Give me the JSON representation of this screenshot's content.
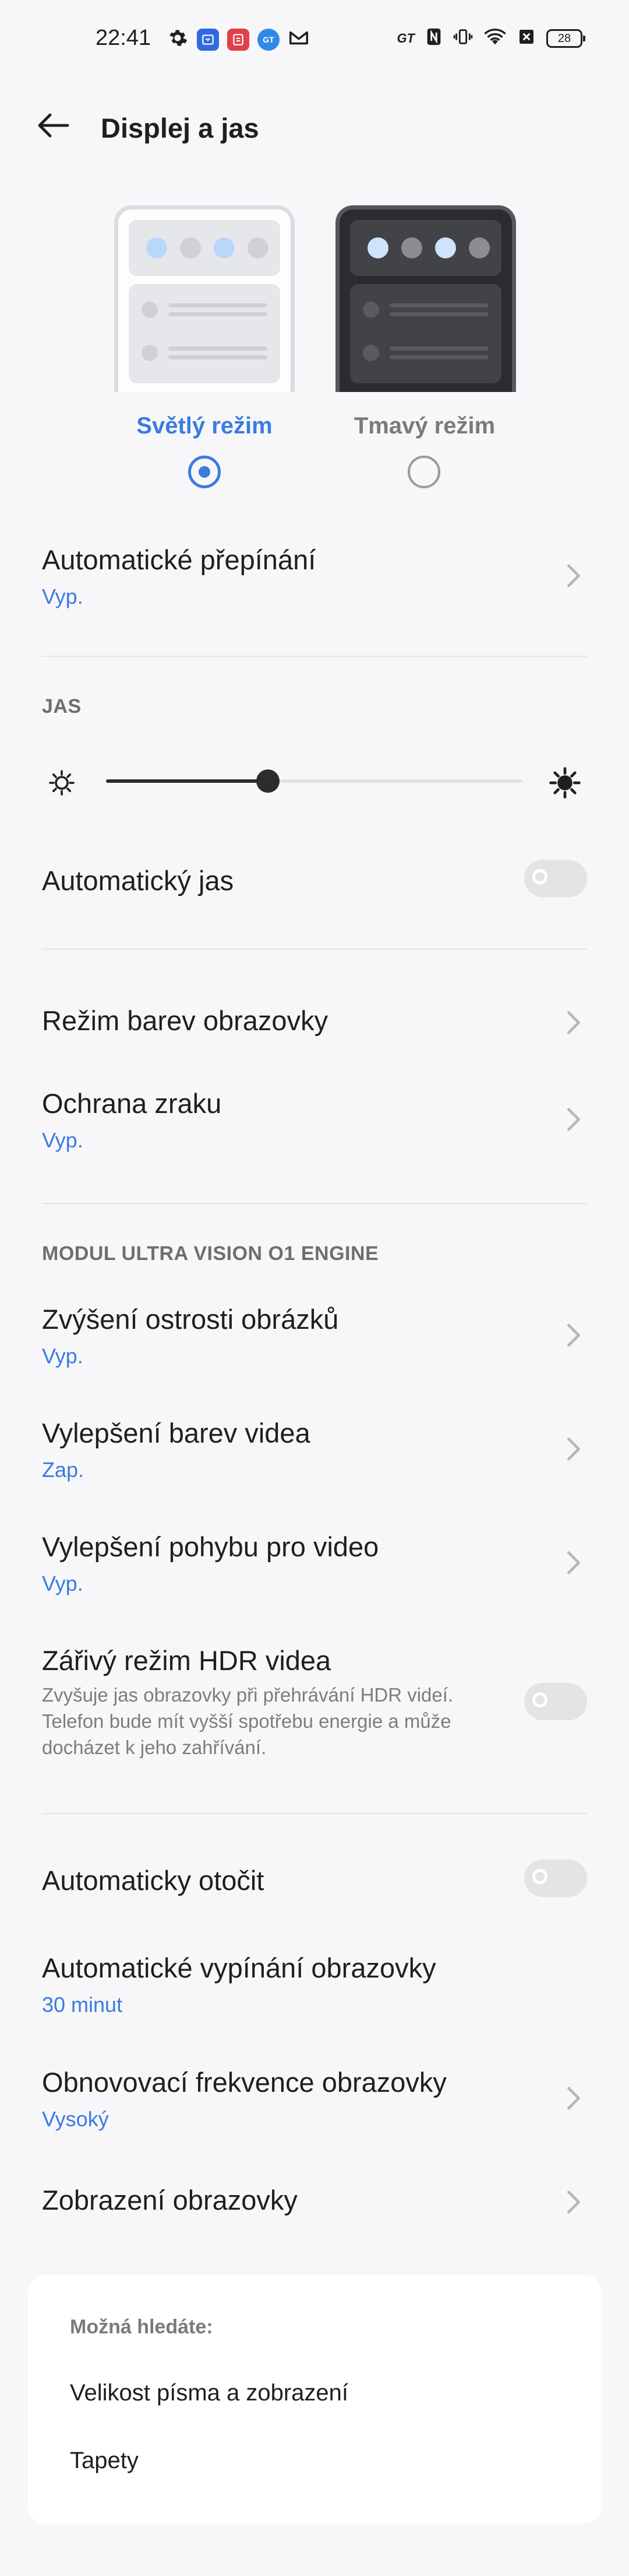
{
  "status_bar": {
    "time": "22:41",
    "left_icons": [
      "gear-icon",
      "app-icon-blue",
      "app-icon-red",
      "app-icon-gt",
      "gmail-icon"
    ],
    "right_icons": [
      "gt-mode-icon",
      "nfc-icon",
      "vibrate-icon",
      "wifi-icon",
      "no-sim-icon"
    ],
    "gt_badge": "GT",
    "battery": "28"
  },
  "header": {
    "title": "Displej a jas"
  },
  "theme": {
    "light_label": "Světlý režim",
    "dark_label": "Tmavý režim",
    "selected": "light",
    "light_dot_colors": [
      "#b9d6fb",
      "#d0d1d5",
      "#b9d6fb",
      "#d0d1d5"
    ],
    "dark_dot_colors": [
      "#cfe3fd",
      "#8c8d91",
      "#cfe3fd",
      "#8c8d91"
    ]
  },
  "auto_switch": {
    "title": "Automatické přepínání",
    "value": "Vyp."
  },
  "brightness": {
    "section": "JAS",
    "level": 0.39
  },
  "auto_brightness": {
    "title": "Automatický jas",
    "on": false
  },
  "color_mode": {
    "title": "Režim barev obrazovky"
  },
  "eye_protection": {
    "title": "Ochrana zraku",
    "value": "Vyp."
  },
  "ultra_vision": {
    "section": "MODUL ULTRA VISION O1 ENGINE",
    "sharpen": {
      "title": "Zvýšení ostrosti obrázků",
      "value": "Vyp."
    },
    "video_color": {
      "title": "Vylepšení barev videa",
      "value": "Zap."
    },
    "video_motion": {
      "title": "Vylepšení pohybu pro video",
      "value": "Vyp."
    },
    "hdr": {
      "title": "Zářivý režim HDR videa",
      "desc": "Zvyšuje jas obrazovky při přehrávání HDR videí. Telefon bude mít vyšší spotřebu energie a může docházet k jeho zahřívání.",
      "on": false
    }
  },
  "auto_rotate": {
    "title": "Automaticky otočit",
    "on": false
  },
  "screen_timeout": {
    "title": "Automatické vypínání obrazovky",
    "value": "30 minut"
  },
  "refresh_rate": {
    "title": "Obnovovací frekvence obrazovky",
    "value": "Vysoký"
  },
  "screen_display": {
    "title": "Zobrazení obrazovky"
  },
  "suggestions": {
    "title": "Možná hledáte:",
    "items": [
      "Velikost písma a zobrazení",
      "Tapety"
    ]
  }
}
